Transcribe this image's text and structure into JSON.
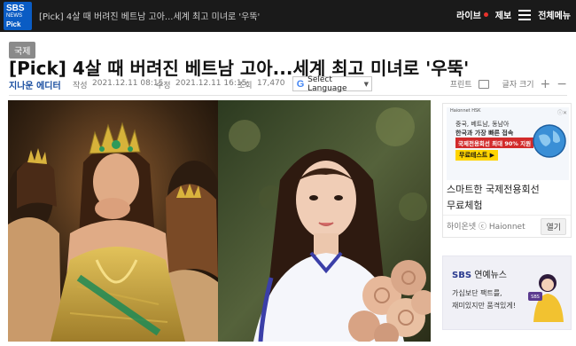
{
  "header": {
    "logo_line1": "SBS",
    "logo_line2": "NEWS",
    "logo_line3": "Pick",
    "top_title": "[Pick] 4살 때 버려진 베트남 고아...세계 최고 미녀로 '우뚝'",
    "live_label": "라이브",
    "report_label": "제보",
    "menu_label": "전체메뉴"
  },
  "article": {
    "category": "국제",
    "headline": "[Pick] 4살 때 버려진 베트남 고아...세계 최고 미녀로 '우뚝'",
    "author": "지나운 에디터",
    "written_label": "작성",
    "written_date": "2021.12.11 08:15",
    "modified_label": "수정",
    "modified_date": "2021.12.11 16:15",
    "views_label": "조회",
    "views": "17,470",
    "translate_label": "Select Language",
    "print_label": "프린트",
    "font_size_label": "글자 크기",
    "font_plus": "+",
    "font_minus": "−"
  },
  "ads": {
    "ad1": {
      "small_text": "Haionnet HSK",
      "banner_line1": "중국, 베트남, 동남아",
      "banner_line2": "한국과 가장 빠른 접속",
      "banner_pill": "국제전용회선 최대 90% 지원",
      "banner_button": "무료테스트 ▶",
      "title": "스마트한 국제전용회선",
      "subtitle": "무료체험",
      "source": "하이온넷 ⓒ Haionnet",
      "go_label": "열기"
    },
    "ad2": {
      "brand_bold": "SBS",
      "brand_rest": " 연예뉴스",
      "line1": "가십보단 팩트를,",
      "line2": "재미있지만 품격있게!"
    }
  },
  "colors": {
    "topbar": "#1a1a1a",
    "brand_blue": "#0a5cc4",
    "author_blue": "#1a4ea0",
    "live_red": "#e8322b"
  }
}
